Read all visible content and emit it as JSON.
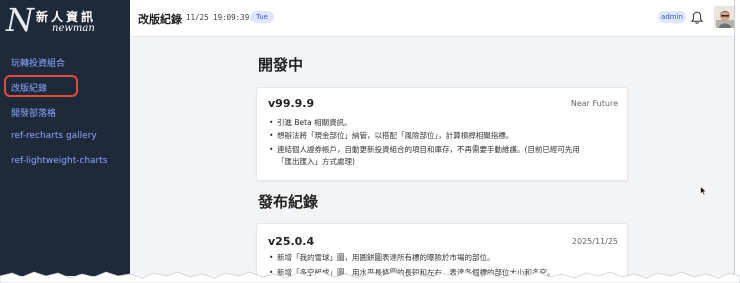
{
  "brand": {
    "initial": "N",
    "name_cn": "新人資訊",
    "name_en": "newman"
  },
  "sidebar": {
    "items": [
      {
        "label": "玩轉投資組合"
      },
      {
        "label": "改版紀錄"
      },
      {
        "label": "開發部落格"
      },
      {
        "label": "ref-recharts gallery"
      },
      {
        "label": "ref-lightweight-charts"
      }
    ]
  },
  "header": {
    "title": "改版紀錄",
    "timestamp": "11/25 19:09:39",
    "day": "Tue",
    "role": "admin",
    "bell_icon": "bell-icon",
    "avatar_icon": "user-avatar"
  },
  "main": {
    "dev_section_title": "開發中",
    "dev_card": {
      "version": "v99.9.9",
      "date": "Near Future",
      "notes": [
        "引進 Beta 相關資訊。",
        "想辦法將「現金部位」納管，以搭配「風險部位」，計算槓桿相關指標。",
        "連結個人證券帳戶，自動更新投資組合的項目和庫存，不再需要手動維護。(目前已經可先用",
        "「匯出匯入」方式處理)"
      ]
    },
    "release_section_title": "發布紀錄",
    "release_card": {
      "version": "v25.0.4",
      "date": "2025/11/25",
      "notes": [
        "新增「我的雪球」圖，用圓餅圖表達所有標的曝險於市場的部位。",
        "新增「多空組成」圖，用水平長條圖的長短和左右，表達各個標的部位大小和多空。"
      ]
    }
  },
  "colors": {
    "sidebar_bg": "#1e2a3a",
    "nav_link": "#8fa4ff",
    "highlight": "#e24a3b",
    "badge_bg": "#dfe6ff",
    "badge_text": "#3b55c9"
  }
}
